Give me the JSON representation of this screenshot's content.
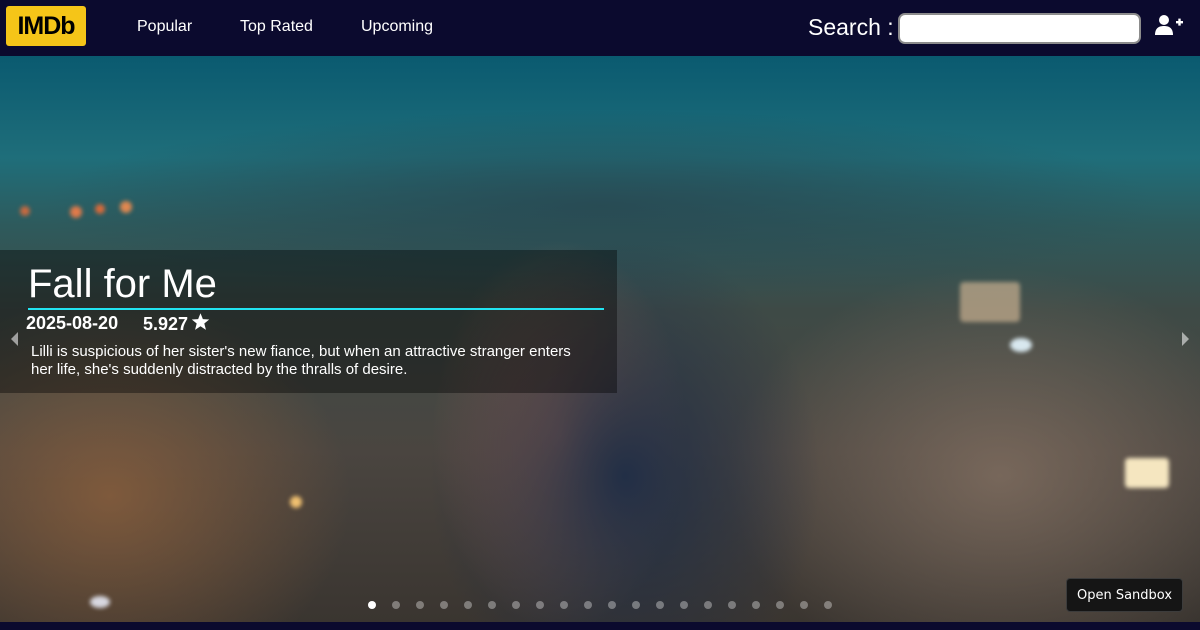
{
  "header": {
    "logo": "IMDb",
    "nav": [
      "Popular",
      "Top Rated",
      "Upcoming"
    ],
    "search_label": "Search :",
    "search_value": "",
    "search_placeholder": "",
    "user_icon": "user-plus-icon"
  },
  "carousel": {
    "title": "Fall for Me",
    "release_date": "2025-08-20",
    "rating": "5.927",
    "overview": "Lilli is suspicious of her sister's new fiance, but when an attractive stranger enters her life, she's suddenly distracted by the thralls of desire.",
    "slide_count": 20,
    "active_slide": 1
  },
  "sandbox_button": "Open Sandbox",
  "colors": {
    "navbar_bg": "#0b0a2e",
    "logo_bg": "#f5c518",
    "accent_underline": "#22e3f0"
  }
}
